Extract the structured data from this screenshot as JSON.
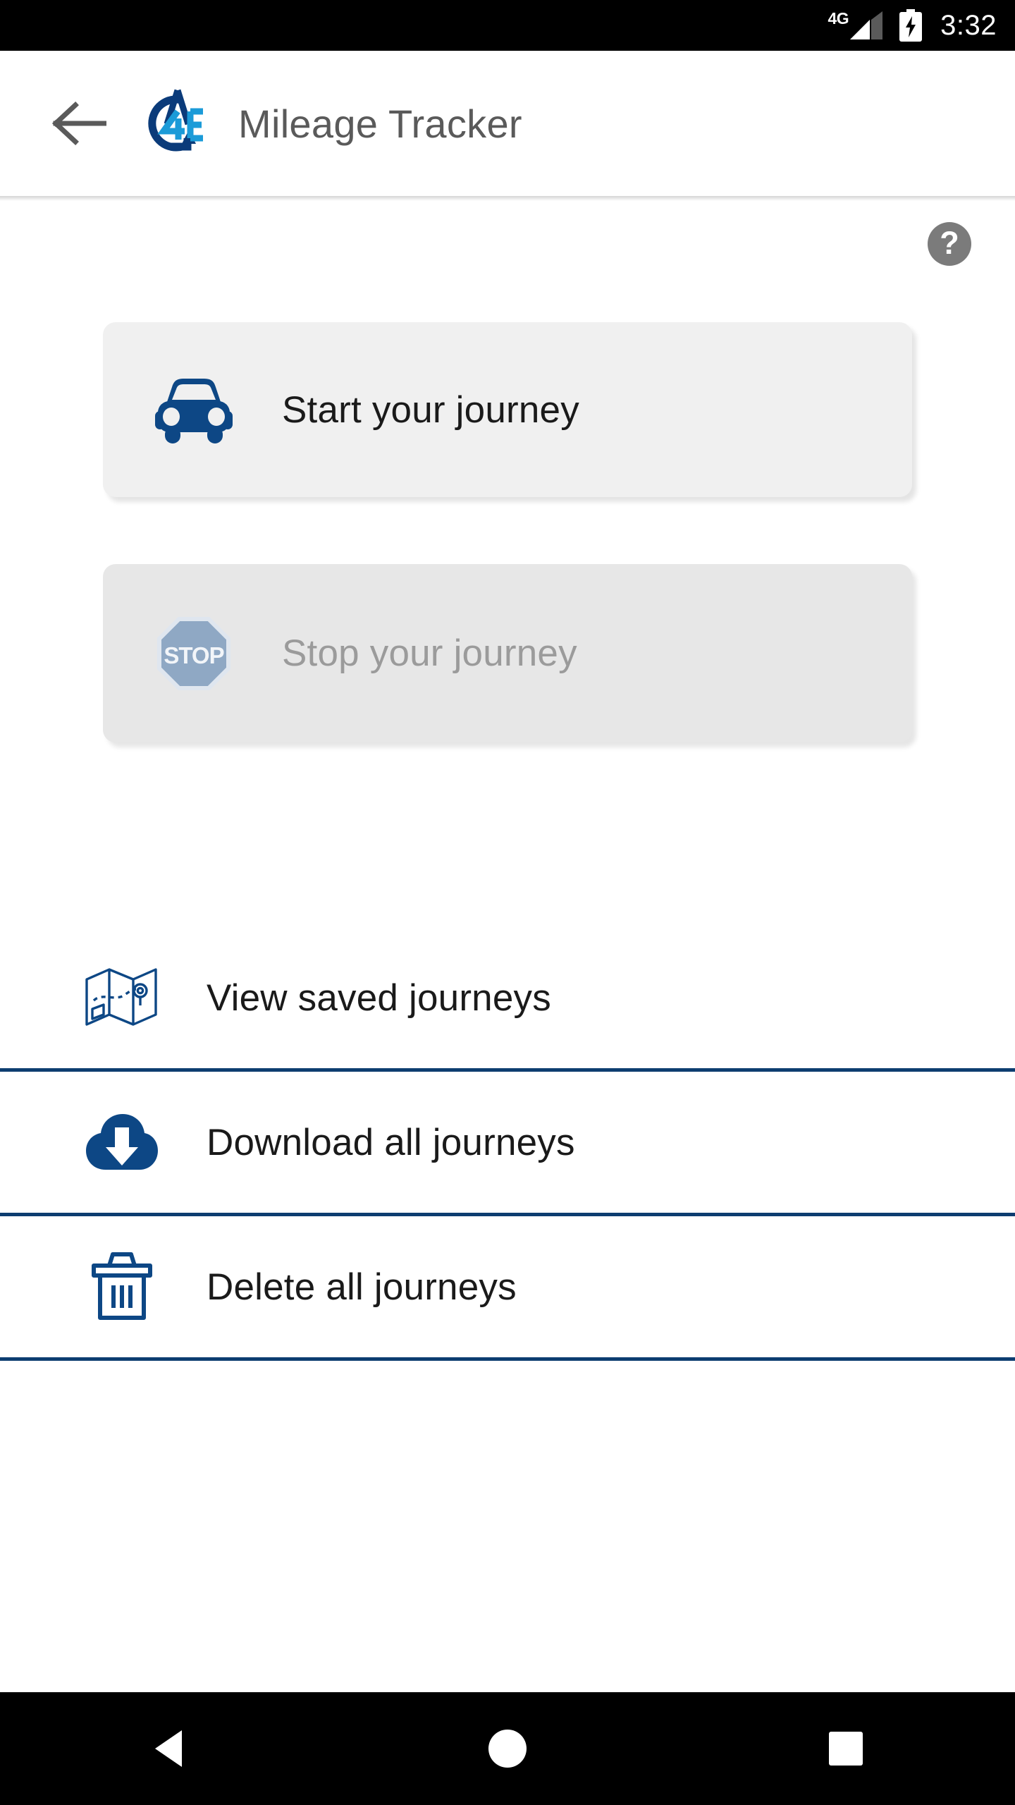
{
  "status_bar": {
    "network_label": "4G",
    "time": "3:32",
    "signal_icon": "signal-bars-icon",
    "battery_icon": "battery-charging-icon"
  },
  "app_bar": {
    "back_icon": "back-arrow-icon",
    "logo_icon": "a4e-logo-icon",
    "logo_letters": {
      "a": "A",
      "four": "4",
      "e": "E"
    },
    "title": "Mileage Tracker"
  },
  "content": {
    "help_button": {
      "label": "?",
      "icon": "help-circle-icon"
    },
    "cards": [
      {
        "id": "start-journey",
        "label": "Start your journey",
        "icon": "car-icon",
        "enabled": true,
        "background": "#f0f0f0",
        "text_color": "#1a1a1a"
      },
      {
        "id": "stop-journey",
        "label": "Stop your journey",
        "icon": "stop-sign-icon",
        "icon_text": "STOP",
        "enabled": false,
        "background": "#e7e7e7",
        "text_color": "#9b9b9b"
      }
    ],
    "menu_items": [
      {
        "id": "view-saved-journeys",
        "label": "View saved journeys",
        "icon": "map-icon"
      },
      {
        "id": "download-all-journeys",
        "label": "Download all journeys",
        "icon": "cloud-download-icon"
      },
      {
        "id": "delete-all-journeys",
        "label": "Delete all journeys",
        "icon": "trash-icon"
      }
    ],
    "divider_color": "#0d3d70"
  },
  "nav_bar": {
    "back": "nav-back-icon",
    "home": "nav-home-icon",
    "recents": "nav-recents-icon"
  },
  "colors": {
    "brand_navy": "#0d4785",
    "brand_light_blue": "#1b9bd8",
    "status_bar_bg": "#000000",
    "title_gray": "#5a5a5a",
    "help_gray": "#7b7b7b",
    "stop_icon_blue": "#8fa8c4"
  }
}
